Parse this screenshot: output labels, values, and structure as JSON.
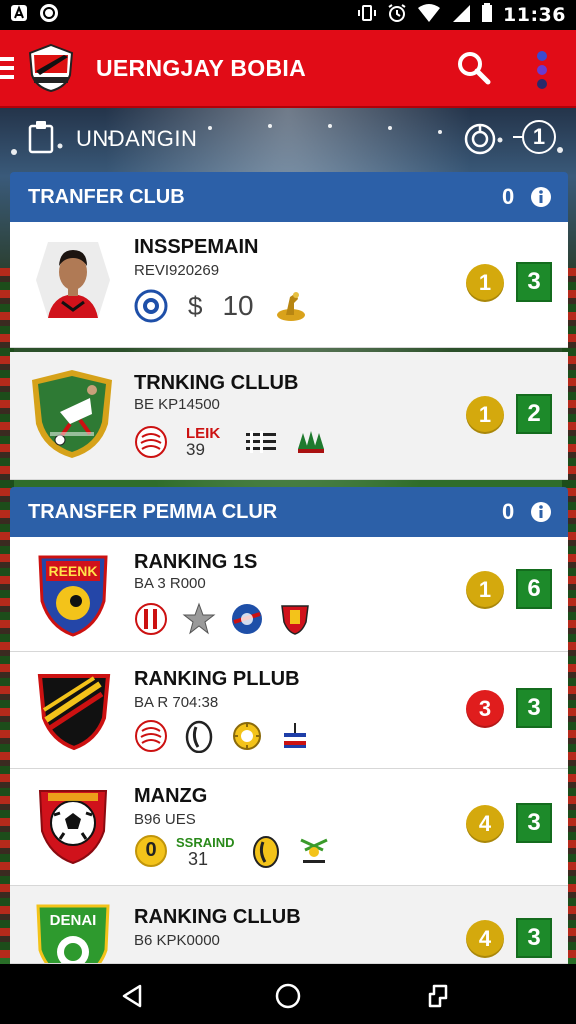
{
  "status_bar": {
    "time": "11:36",
    "icons": [
      "notification-a-icon",
      "sync-icon",
      "vibrate-icon",
      "alarm-icon",
      "wifi-icon",
      "signal-icon",
      "battery-icon"
    ]
  },
  "app_bar": {
    "title": "UERNGJAY BOBIA",
    "colors": {
      "background": "#e10c17"
    },
    "icons": [
      "menu-icon",
      "club-logo",
      "search-icon",
      "more-icon"
    ]
  },
  "sub_header": {
    "title": "UNDANGIN",
    "count": "1"
  },
  "sections": [
    {
      "title": "TRANFER CLUB",
      "count": "0",
      "cards": [
        {
          "title": "INSSPEMAIN",
          "subtitle": "REVI920269",
          "stat_symbol": "$",
          "stat_value": "10",
          "rank": "1",
          "rank_color": "#d4a90d",
          "score": "3"
        },
        {
          "title": "TRNKING CLLUB",
          "subtitle": "BE KP14500",
          "icon_label_top": "LEIK",
          "icon_label_bottom": "39",
          "rank": "1",
          "rank_color": "#d4a90d",
          "score": "2"
        }
      ]
    },
    {
      "title": "TRANSFER PEMMA CLUR",
      "count": "0",
      "cards": [
        {
          "title": "RANKING 1S",
          "subtitle": "BA 3 R000",
          "badge_text": "REENK",
          "rank": "1",
          "rank_color": "#d4a90d",
          "score": "6"
        },
        {
          "title": "RANKING PLLUB",
          "subtitle": "BA R 704:38",
          "rank": "3",
          "rank_color": "#e01d1d",
          "score": "3"
        },
        {
          "title": "MANZG",
          "subtitle": "B96 UES",
          "icon_badge_num": "0",
          "icon_label_top": "SSRAIND",
          "icon_label_bottom": "31",
          "rank": "4",
          "rank_color": "#d4a90d",
          "score": "3"
        },
        {
          "title": "RANKING CLLUB",
          "subtitle": "B6 KPK0000",
          "badge_text": "DENAI",
          "rank": "4",
          "rank_color": "#d4a90d",
          "score": "3"
        }
      ]
    }
  ],
  "nav_bar": {
    "icons": [
      "back-icon",
      "home-icon",
      "recent-apps-icon"
    ]
  }
}
